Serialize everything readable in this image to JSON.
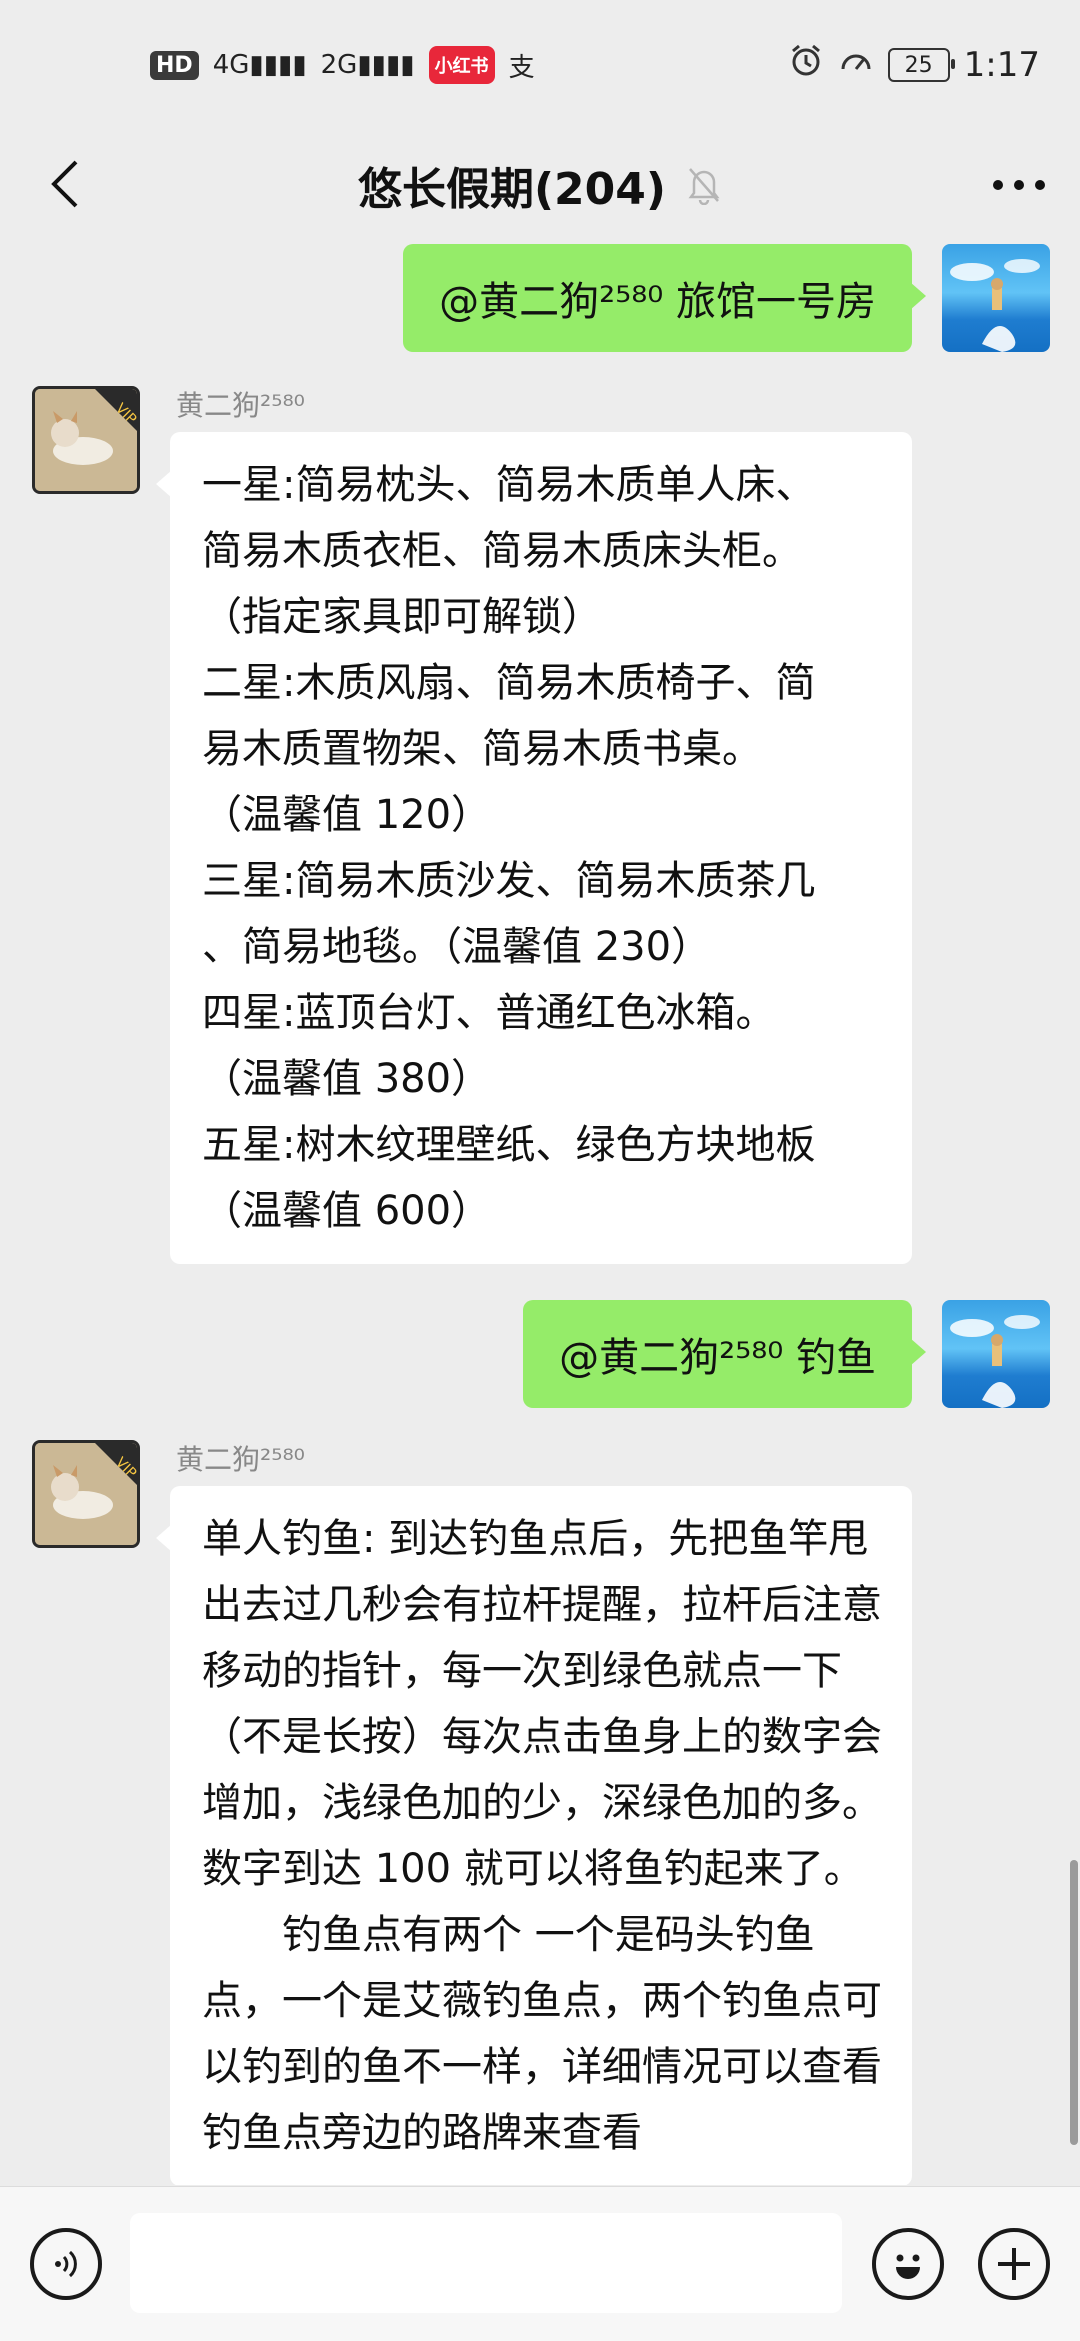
{
  "status_bar": {
    "hd": "HD",
    "signal1": "4G",
    "signal2": "2G",
    "app_badge": "小红书",
    "alipay": "支",
    "battery": "25",
    "time": "1:17"
  },
  "header": {
    "title": "悠长假期(204)"
  },
  "messages": [
    {
      "from": "me",
      "text": "@黄二狗²⁵⁸⁰ 旅馆一号房"
    },
    {
      "from": "other",
      "sender": "黄二狗²⁵⁸⁰",
      "lines": [
        "一星:简易枕头、简易木质单人床、",
        "简易木质衣柜、简易木质床头柜。",
        "（指定家具即可解锁）",
        "二星:木质风扇、简易木质椅子、简",
        "易木质置物架、简易木质书桌。",
        "（温馨值 120）",
        "三星:简易木质沙发、简易木质茶几",
        "、简易地毯。（温馨值 230）",
        "四星:蓝顶台灯、普通红色冰箱。",
        "（温馨值 380）",
        "五星:树木纹理壁纸、绿色方块地板",
        "（温馨值 600）"
      ]
    },
    {
      "from": "me",
      "text": "@黄二狗²⁵⁸⁰ 钓鱼"
    },
    {
      "from": "other",
      "sender": "黄二狗²⁵⁸⁰",
      "para1": "单人钓鱼: 到达钓鱼点后，先把鱼竿甩出去过几秒会有拉杆提醒，拉杆后注意移动的指针，每一次到绿色就点一下（不是长按）每次点击鱼身上的数字会增加，浅绿色加的少，深绿色加的多。数字到达 100 就可以将鱼钓起来了。",
      "para2": "钓鱼点有两个 一个是码头钓鱼点，一个是艾薇钓鱼点，两个钓鱼点可以钓到的鱼不一样，详细情况可以查看钓鱼点旁边的路牌来查看"
    }
  ],
  "input_bar": {
    "placeholder": ""
  }
}
